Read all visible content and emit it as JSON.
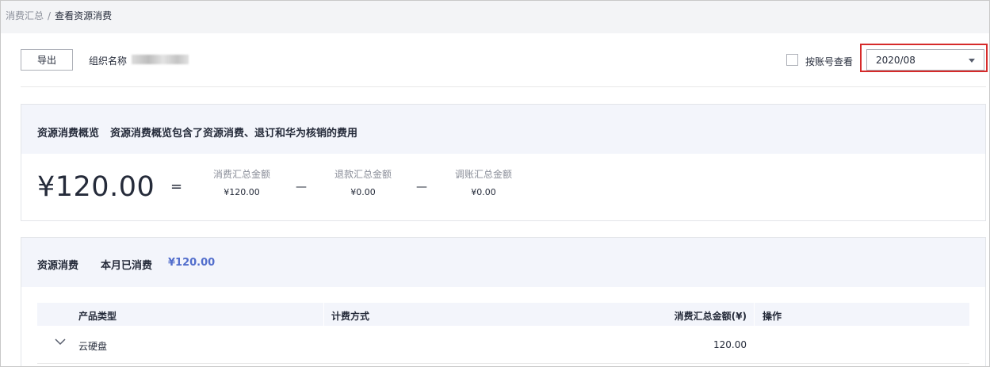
{
  "breadcrumb": {
    "parent": "消费汇总",
    "separator": "/",
    "current": "查看资源消费"
  },
  "toolbar": {
    "export_label": "导出",
    "org_label": "组织名称",
    "by_account_label": "按账号查看",
    "by_account_checked": false,
    "month_value": "2020/08"
  },
  "overview": {
    "title": "资源消费概览",
    "subtitle": "资源消费概览包含了资源消费、退订和华为核销的费用",
    "total": "¥120.00",
    "equals": "=",
    "minus": "—",
    "metrics": [
      {
        "label": "消费汇总金额",
        "value": "¥120.00"
      },
      {
        "label": "退款汇总金额",
        "value": "¥0.00"
      },
      {
        "label": "调账汇总金额",
        "value": "¥0.00"
      }
    ]
  },
  "consumption": {
    "title": "资源消费",
    "month_label": "本月已消费",
    "month_amount": "¥120.00",
    "columns": [
      "产品类型",
      "计费方式",
      "消费汇总金额(¥)",
      "操作"
    ],
    "rows": [
      {
        "product": "云硬盘",
        "billing": "",
        "amount": "120.00",
        "action": ""
      }
    ]
  },
  "colors": {
    "accent": "#526ecc",
    "highlight": "#d62a2a",
    "header_bg": "#f3f5fb"
  }
}
